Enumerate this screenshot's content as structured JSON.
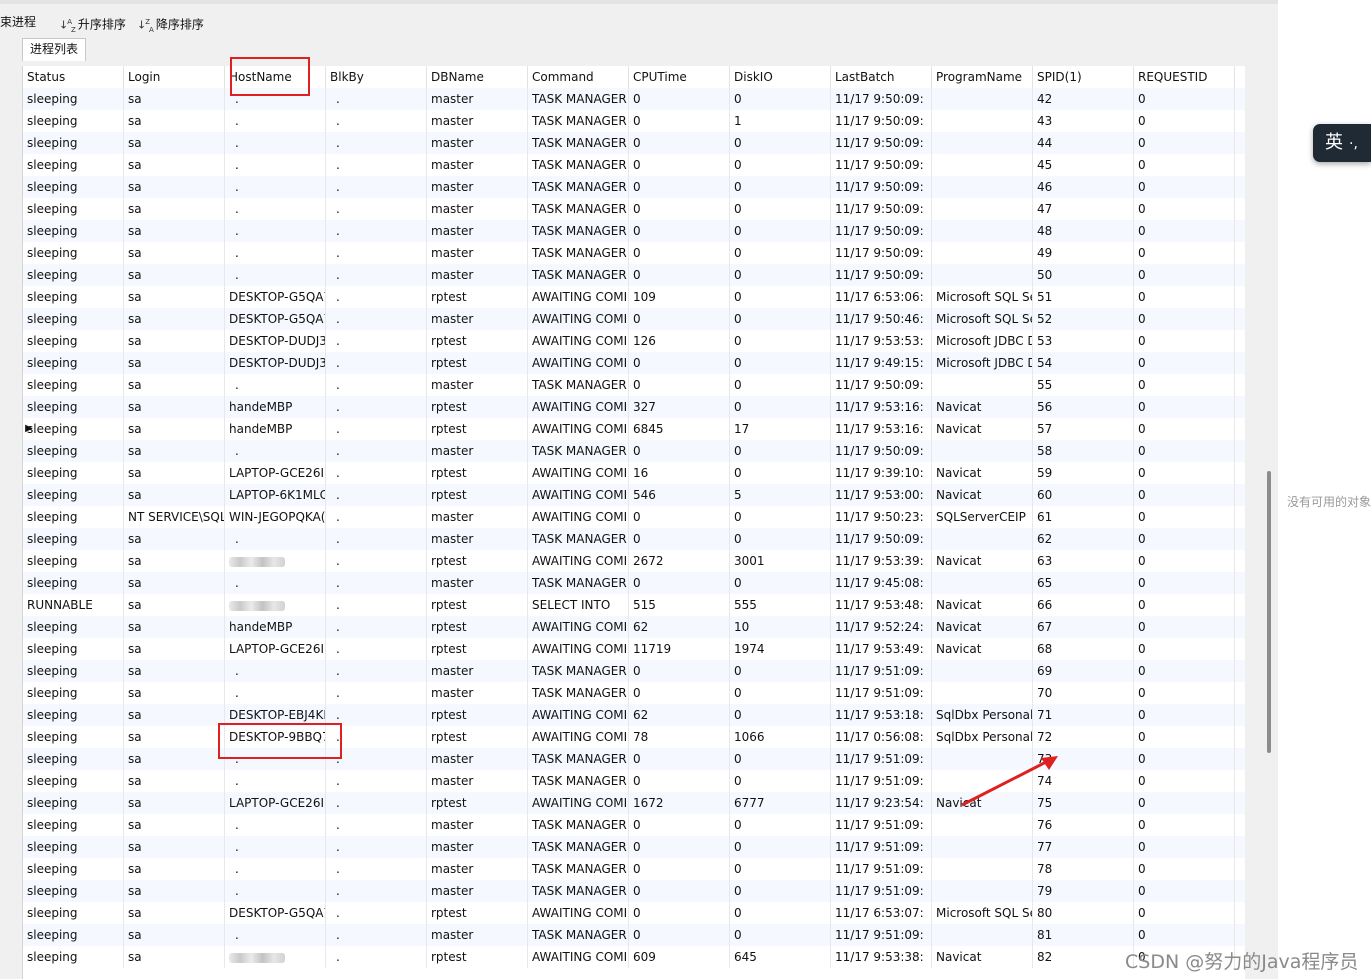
{
  "toolbar": {
    "end_process_label": "束进程",
    "sort_asc_label": "升序排序",
    "sort_desc_label": "降序排序"
  },
  "tab": {
    "label": "进程列表"
  },
  "columns": [
    "Status",
    "Login",
    "HostName",
    "BlkBy",
    "DBName",
    "Command",
    "CPUTime",
    "DiskIO",
    "LastBatch",
    "ProgramName",
    "SPID(1)",
    "REQUESTID"
  ],
  "rows": [
    [
      "sleeping",
      "sa",
      ".",
      ".",
      "master",
      "TASK MANAGER",
      "0",
      "0",
      "11/17 9:50:09:",
      "",
      "42",
      "0"
    ],
    [
      "sleeping",
      "sa",
      ".",
      ".",
      "master",
      "TASK MANAGER",
      "0",
      "1",
      "11/17 9:50:09:",
      "",
      "43",
      "0"
    ],
    [
      "sleeping",
      "sa",
      ".",
      ".",
      "master",
      "TASK MANAGER",
      "0",
      "0",
      "11/17 9:50:09:",
      "",
      "44",
      "0"
    ],
    [
      "sleeping",
      "sa",
      ".",
      ".",
      "master",
      "TASK MANAGER",
      "0",
      "0",
      "11/17 9:50:09:",
      "",
      "45",
      "0"
    ],
    [
      "sleeping",
      "sa",
      ".",
      ".",
      "master",
      "TASK MANAGER",
      "0",
      "0",
      "11/17 9:50:09:",
      "",
      "46",
      "0"
    ],
    [
      "sleeping",
      "sa",
      ".",
      ".",
      "master",
      "TASK MANAGER",
      "0",
      "0",
      "11/17 9:50:09:",
      "",
      "47",
      "0"
    ],
    [
      "sleeping",
      "sa",
      ".",
      ".",
      "master",
      "TASK MANAGER",
      "0",
      "0",
      "11/17 9:50:09:",
      "",
      "48",
      "0"
    ],
    [
      "sleeping",
      "sa",
      ".",
      ".",
      "master",
      "TASK MANAGER",
      "0",
      "0",
      "11/17 9:50:09:",
      "",
      "49",
      "0"
    ],
    [
      "sleeping",
      "sa",
      ".",
      ".",
      "master",
      "TASK MANAGER",
      "0",
      "0",
      "11/17 9:50:09:",
      "",
      "50",
      "0"
    ],
    [
      "sleeping",
      "sa",
      "DESKTOP-G5QA7",
      ".",
      "rptest",
      "AWAITING COMI",
      "109",
      "0",
      "11/17 6:53:06:",
      "Microsoft SQL Se",
      "51",
      "0"
    ],
    [
      "sleeping",
      "sa",
      "DESKTOP-G5QA7",
      ".",
      "master",
      "AWAITING COMI",
      "0",
      "0",
      "11/17 9:50:46:",
      "Microsoft SQL Se",
      "52",
      "0"
    ],
    [
      "sleeping",
      "sa",
      "DESKTOP-DUDJ3",
      ".",
      "rptest",
      "AWAITING COMI",
      "126",
      "0",
      "11/17 9:53:53:",
      "Microsoft JDBC D",
      "53",
      "0"
    ],
    [
      "sleeping",
      "sa",
      "DESKTOP-DUDJ3",
      ".",
      "rptest",
      "AWAITING COMI",
      "0",
      "0",
      "11/17 9:49:15:",
      "Microsoft JDBC D",
      "54",
      "0"
    ],
    [
      "sleeping",
      "sa",
      ".",
      ".",
      "master",
      "TASK MANAGER",
      "0",
      "0",
      "11/17 9:50:09:",
      "",
      "55",
      "0"
    ],
    [
      "sleeping",
      "sa",
      "handeMBP",
      ".",
      "rptest",
      "AWAITING COMI",
      "327",
      "0",
      "11/17 9:53:16:",
      "Navicat",
      "56",
      "0"
    ],
    [
      "sleeping",
      "sa",
      "handeMBP",
      ".",
      "rptest",
      "AWAITING COMI",
      "6845",
      "17",
      "11/17 9:53:16:",
      "Navicat",
      "57",
      "0"
    ],
    [
      "sleeping",
      "sa",
      ".",
      ".",
      "master",
      "TASK MANAGER",
      "0",
      "0",
      "11/17 9:50:09:",
      "",
      "58",
      "0"
    ],
    [
      "sleeping",
      "sa",
      "LAPTOP-GCE26II'",
      ".",
      "rptest",
      "AWAITING COMI",
      "16",
      "0",
      "11/17 9:39:10:",
      "Navicat",
      "59",
      "0"
    ],
    [
      "sleeping",
      "sa",
      "LAPTOP-6K1MLC",
      ".",
      "rptest",
      "AWAITING COMI",
      "546",
      "5",
      "11/17 9:53:00:",
      "Navicat",
      "60",
      "0"
    ],
    [
      "sleeping",
      "NT SERVICE\\SQL",
      "WIN-JEGOPQKA(",
      ".",
      "master",
      "AWAITING COMI",
      "0",
      "0",
      "11/17 9:50:23:",
      "SQLServerCEIP",
      "61",
      "0"
    ],
    [
      "sleeping",
      "sa",
      ".",
      ".",
      "master",
      "TASK MANAGER",
      "0",
      "0",
      "11/17 9:50:09:",
      "",
      "62",
      "0"
    ],
    [
      "sleeping",
      "sa",
      "",
      ".",
      "rptest",
      "AWAITING COMI",
      "2672",
      "3001",
      "11/17 9:53:39:",
      "Navicat",
      "63",
      "0"
    ],
    [
      "sleeping",
      "sa",
      ".",
      ".",
      "master",
      "TASK MANAGER",
      "0",
      "0",
      "11/17 9:45:08:",
      "",
      "65",
      "0"
    ],
    [
      "RUNNABLE",
      "sa",
      "",
      ".",
      "rptest",
      "SELECT INTO",
      "515",
      "555",
      "11/17 9:53:48:",
      "Navicat",
      "66",
      "0"
    ],
    [
      "sleeping",
      "sa",
      "handeMBP",
      ".",
      "rptest",
      "AWAITING COMI",
      "62",
      "10",
      "11/17 9:52:24:",
      "Navicat",
      "67",
      "0"
    ],
    [
      "sleeping",
      "sa",
      "LAPTOP-GCE26II'",
      ".",
      "rptest",
      "AWAITING COMI",
      "11719",
      "1974",
      "11/17 9:53:49:",
      "Navicat",
      "68",
      "0"
    ],
    [
      "sleeping",
      "sa",
      ".",
      ".",
      "master",
      "TASK MANAGER",
      "0",
      "0",
      "11/17 9:51:09:",
      "",
      "69",
      "0"
    ],
    [
      "sleeping",
      "sa",
      ".",
      ".",
      "master",
      "TASK MANAGER",
      "0",
      "0",
      "11/17 9:51:09:",
      "",
      "70",
      "0"
    ],
    [
      "sleeping",
      "sa",
      "DESKTOP-EBJ4KI",
      ".",
      "rptest",
      "AWAITING COMI",
      "62",
      "0",
      "11/17 9:53:18:",
      "SqlDbx Personal",
      "71",
      "0"
    ],
    [
      "sleeping",
      "sa",
      "DESKTOP-9BBQ7",
      ".",
      "rptest",
      "AWAITING COMI",
      "78",
      "1066",
      "11/17 0:56:08:",
      "SqlDbx Personal",
      "72",
      "0"
    ],
    [
      "sleeping",
      "sa",
      ".",
      ".",
      "master",
      "TASK MANAGER",
      "0",
      "0",
      "11/17 9:51:09:",
      "",
      "73",
      "0"
    ],
    [
      "sleeping",
      "sa",
      ".",
      ".",
      "master",
      "TASK MANAGER",
      "0",
      "0",
      "11/17 9:51:09:",
      "",
      "74",
      "0"
    ],
    [
      "sleeping",
      "sa",
      "LAPTOP-GCE26II'",
      ".",
      "rptest",
      "AWAITING COMI",
      "1672",
      "6777",
      "11/17 9:23:54:",
      "Navicat",
      "75",
      "0"
    ],
    [
      "sleeping",
      "sa",
      ".",
      ".",
      "master",
      "TASK MANAGER",
      "0",
      "0",
      "11/17 9:51:09:",
      "",
      "76",
      "0"
    ],
    [
      "sleeping",
      "sa",
      ".",
      ".",
      "master",
      "TASK MANAGER",
      "0",
      "0",
      "11/17 9:51:09:",
      "",
      "77",
      "0"
    ],
    [
      "sleeping",
      "sa",
      ".",
      ".",
      "master",
      "TASK MANAGER",
      "0",
      "0",
      "11/17 9:51:09:",
      "",
      "78",
      "0"
    ],
    [
      "sleeping",
      "sa",
      ".",
      ".",
      "master",
      "TASK MANAGER",
      "0",
      "0",
      "11/17 9:51:09:",
      "",
      "79",
      "0"
    ],
    [
      "sleeping",
      "sa",
      "DESKTOP-G5QA7",
      ".",
      "rptest",
      "AWAITING COMI",
      "0",
      "0",
      "11/17 6:53:07:",
      "Microsoft SQL Se",
      "80",
      "0"
    ],
    [
      "sleeping",
      "sa",
      ".",
      ".",
      "master",
      "TASK MANAGER",
      "0",
      "0",
      "11/17 9:51:09:",
      "",
      "81",
      "0"
    ],
    [
      "sleeping",
      "sa",
      "",
      ".",
      "rptest",
      "AWAITING COMI",
      "609",
      "645",
      "11/17 9:53:38:",
      "Navicat",
      "82",
      "0"
    ]
  ],
  "blurred_hostname_rows": [
    21,
    23,
    39
  ],
  "selected_row_index": 15,
  "ime_indicator": {
    "label": "英",
    "extra": "·,"
  },
  "side_message": "没有可用的对象",
  "watermark": "CSDN @努力的Java程序员",
  "colors": {
    "highlight_box": "#e02020",
    "alt_row": "#f5f9ff"
  }
}
